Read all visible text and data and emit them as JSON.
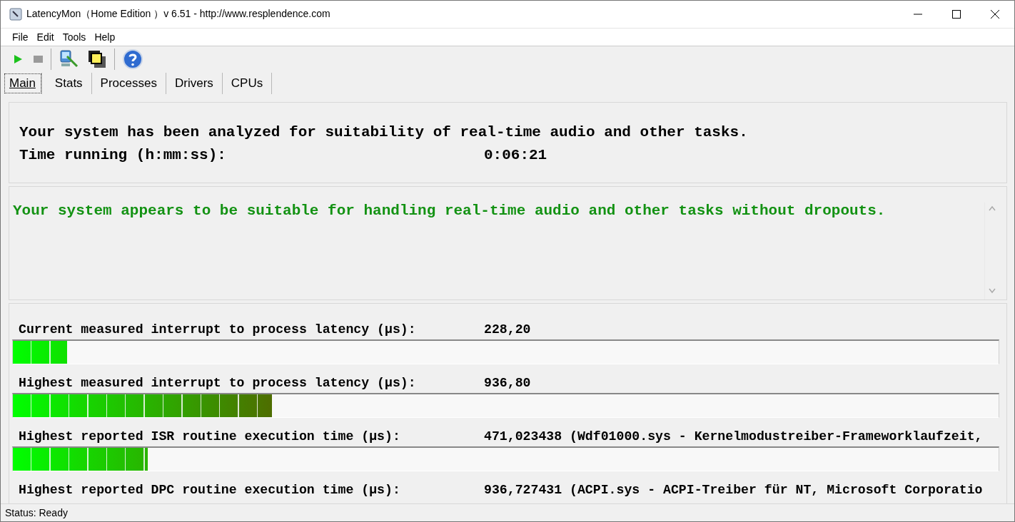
{
  "window": {
    "title": "LatencyMon（Home Edition ）v 6.51 - http://www.resplendence.com"
  },
  "menu": [
    "File",
    "Edit",
    "Tools",
    "Help"
  ],
  "tabs": [
    {
      "label": "Main",
      "selected": true
    },
    {
      "label": "Stats",
      "selected": false
    },
    {
      "label": "Processes",
      "selected": false
    },
    {
      "label": "Drivers",
      "selected": false
    },
    {
      "label": "CPUs",
      "selected": false
    }
  ],
  "summary": {
    "line": "Your system has been analyzed for suitability of real-time audio and other tasks.",
    "time_label": "Time running (h:mm:ss):",
    "time_value": "0:06:21"
  },
  "verdict": "Your system appears to be suitable for handling real-time audio and other tasks without dropouts.",
  "measurements": [
    {
      "label": "Current measured interrupt to process latency (µs):",
      "value": "228,20",
      "level": 0.055
    },
    {
      "label": "Highest measured interrupt to process latency (µs):",
      "value": "936,80",
      "level": 0.263
    },
    {
      "label": "Highest reported ISR routine execution time (µs):",
      "value": "471,023438",
      "level": 0.137,
      "driver": "(Wdf01000.sys - Kernelmodustreiber-Frameworklaufzeit,"
    },
    {
      "label": "Highest reported DPC routine execution time (µs):",
      "value": "936,727431",
      "driver": "(ACPI.sys - ACPI-Treiber für NT, Microsoft Corporatio"
    }
  ],
  "status_bar": "Status: Ready"
}
